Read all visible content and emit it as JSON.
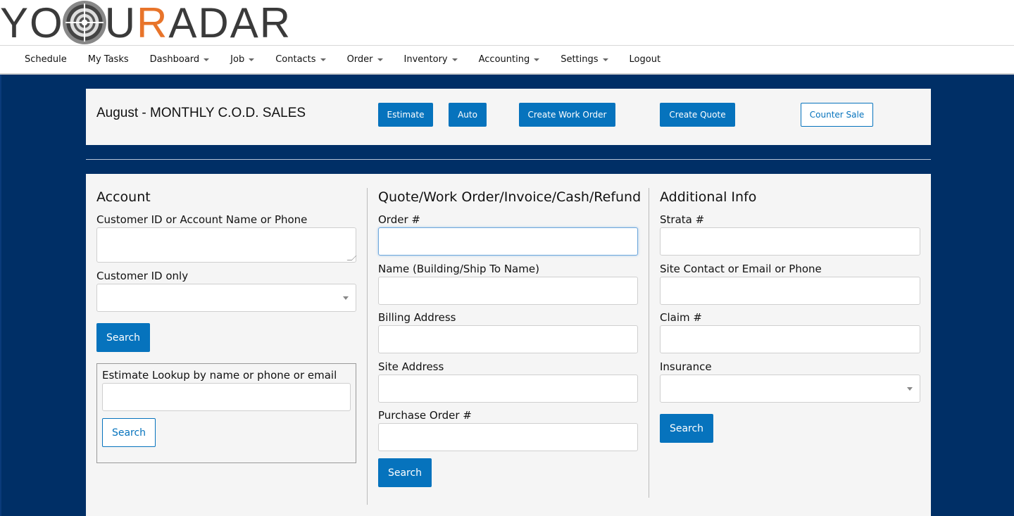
{
  "logo": {
    "text_pre": "YO",
    "text_mid": "U",
    "text_r": "R",
    "text_post": "ADAR"
  },
  "nav": [
    {
      "label": "Schedule",
      "dropdown": false
    },
    {
      "label": "My Tasks",
      "dropdown": false
    },
    {
      "label": "Dashboard",
      "dropdown": true
    },
    {
      "label": "Job",
      "dropdown": true
    },
    {
      "label": "Contacts",
      "dropdown": true
    },
    {
      "label": "Order",
      "dropdown": true
    },
    {
      "label": "Inventory",
      "dropdown": true
    },
    {
      "label": "Accounting",
      "dropdown": true
    },
    {
      "label": "Settings",
      "dropdown": true
    },
    {
      "label": "Logout",
      "dropdown": false
    }
  ],
  "topcard": {
    "title": "August - MONTHLY C.O.D. SALES",
    "estimate": "Estimate",
    "auto": "Auto",
    "create_work_order": "Create Work Order",
    "create_quote": "Create Quote",
    "counter_sale": "Counter Sale"
  },
  "account": {
    "heading": "Account",
    "cust_label": "Customer ID or Account Name or Phone",
    "cust_value": "",
    "cust_only_label": "Customer ID only",
    "cust_only_value": "",
    "search": "Search",
    "lookup_label": "Estimate Lookup by name or phone or email",
    "lookup_value": "",
    "lookup_search": "Search"
  },
  "order": {
    "heading": "Quote/Work Order/Invoice/Cash/Refund",
    "order_label": "Order #",
    "name_label": "Name (Building/Ship To Name)",
    "billing_label": "Billing Address",
    "site_label": "Site Address",
    "po_label": "Purchase Order #",
    "search": "Search"
  },
  "additional": {
    "heading": "Additional Info",
    "strata_label": "Strata #",
    "contact_label": "Site Contact or Email or Phone",
    "claim_label": "Claim #",
    "insurance_label": "Insurance",
    "search": "Search"
  },
  "colors": {
    "primary": "#0673bd",
    "background": "#002f66",
    "logo_accent": "#e8742a"
  }
}
